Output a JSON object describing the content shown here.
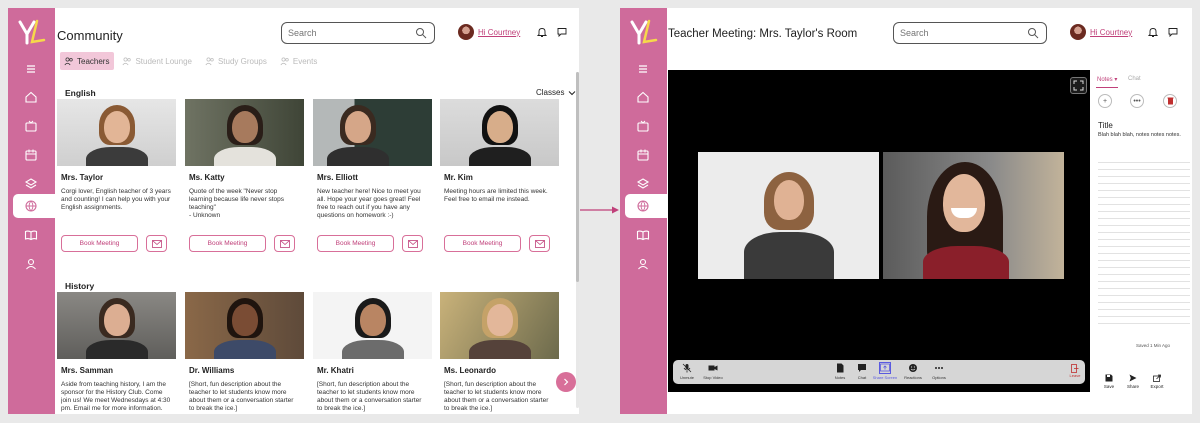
{
  "community": {
    "title": "Community",
    "search_placeholder": "Search",
    "user_greeting": "Hi Courtney",
    "tabs": [
      {
        "label": "Teachers",
        "active": true
      },
      {
        "label": "Student Lounge",
        "active": false
      },
      {
        "label": "Study Groups",
        "active": false
      },
      {
        "label": "Events",
        "active": false
      }
    ],
    "filter_label": "Classes",
    "sections": [
      {
        "title": "English",
        "teachers": [
          {
            "name": "Mrs. Taylor",
            "desc": "Corgi lover, English teacher of 3 years and counting! I can help you with your English assignments.",
            "book_label": "Book Meeting"
          },
          {
            "name": "Ms. Katty",
            "desc": "Quote of the week \"Never stop learning because life never stops teaching\"\n- Unknown",
            "book_label": "Book Meeting"
          },
          {
            "name": "Mrs. Elliott",
            "desc": "New teacher here! Nice to meet you all. Hope your year goes great! Feel free to reach out if you have any questions on homework :-)",
            "book_label": "Book Meeting"
          },
          {
            "name": "Mr. Kim",
            "desc": "Meeting hours are limited this week. Feel free to email me instead.",
            "book_label": "Book Meeting"
          }
        ]
      },
      {
        "title": "History",
        "teachers": [
          {
            "name": "Mrs. Samman",
            "desc": "Aside from teaching history, I am the sponsor for the History Club. Come join us! We meet Wednesdays at 4:30 pm. Email me for more information."
          },
          {
            "name": "Dr. Williams",
            "desc": "[Short, fun description about the teacher to let students know more about them or a conversation starter to break the ice.]"
          },
          {
            "name": "Mr. Khatri",
            "desc": "[Short, fun description about the teacher to let students know more about them or a conversation starter to break the ice.]"
          },
          {
            "name": "Ms. Leonardo",
            "desc": "[Short, fun description about the teacher to let students know more about them or a conversation starter to break the ice.]"
          }
        ]
      }
    ]
  },
  "meeting": {
    "title": "Teacher Meeting: Mrs. Taylor's Room",
    "search_placeholder": "Search",
    "user_greeting": "Hi Courtney",
    "controls": [
      {
        "label": "Unmute",
        "icon": "mic-off-icon"
      },
      {
        "label": "Stop Video",
        "icon": "camera-icon"
      },
      {
        "label": "Notes",
        "icon": "notes-icon"
      },
      {
        "label": "Chat",
        "icon": "chat-icon"
      },
      {
        "label": "Share Screen",
        "icon": "share-screen-icon"
      },
      {
        "label": "Reactions",
        "icon": "reactions-icon"
      },
      {
        "label": "Options",
        "icon": "more-icon"
      }
    ],
    "leave_label": "Leave",
    "notes": {
      "tab_notes": "Notes ▾",
      "tab_chat": "Chat",
      "title": "Title",
      "body": "Blah blah blah, notes notes notes.",
      "saved": "Saved 1 Min Ago",
      "actions": [
        "Save",
        "Share",
        "Export"
      ]
    }
  },
  "colors": {
    "brand": "#cf6b9b",
    "accent": "#c0407a",
    "tab_active": "#f2c7d9"
  }
}
